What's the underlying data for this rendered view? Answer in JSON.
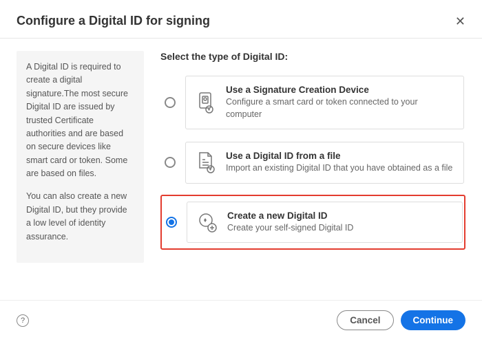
{
  "header": {
    "title": "Configure a Digital ID for signing"
  },
  "sidebar": {
    "p1": "A Digital ID is required to create a digital signature.The most secure Digital ID are issued by trusted Certificate authorities and are based on secure devices like smart card or token. Some are based on files.",
    "p2": "You can also create a new Digital ID, but they provide a low level of identity assurance."
  },
  "main": {
    "title": "Select the type of Digital ID:",
    "options": [
      {
        "title": "Use a Signature Creation Device",
        "desc": "Configure a smart card or token connected to your computer",
        "selected": false,
        "highlighted": false
      },
      {
        "title": "Use a Digital ID from a file",
        "desc": "Import an existing Digital ID that you have obtained as a file",
        "selected": false,
        "highlighted": false
      },
      {
        "title": "Create a new Digital ID",
        "desc": "Create your self-signed Digital ID",
        "selected": true,
        "highlighted": true
      }
    ]
  },
  "footer": {
    "cancel": "Cancel",
    "continue": "Continue"
  }
}
